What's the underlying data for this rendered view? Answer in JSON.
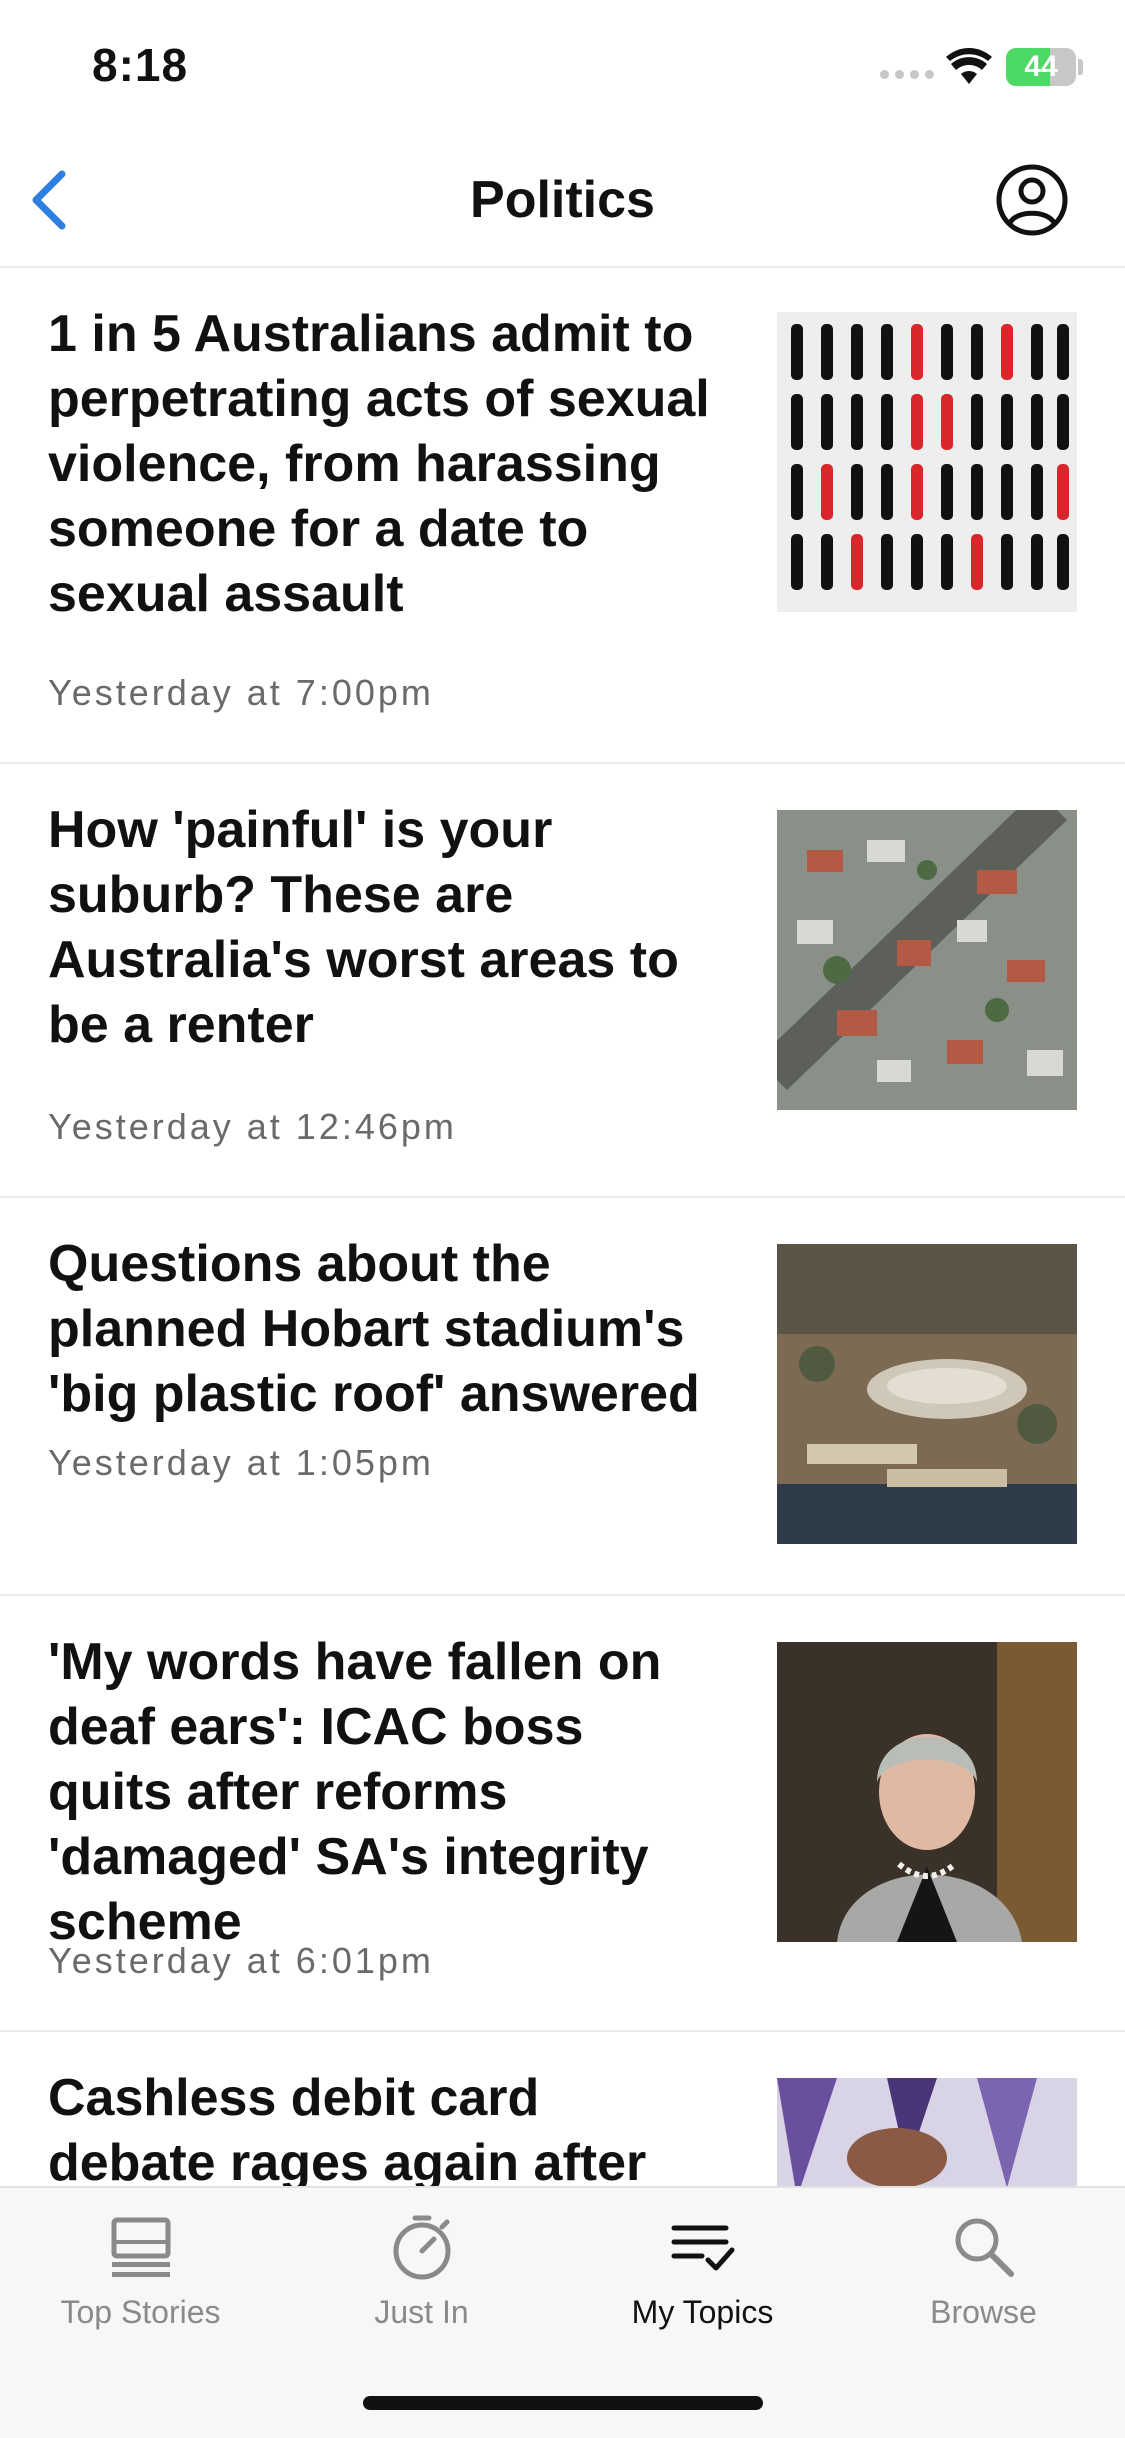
{
  "status_bar": {
    "time": "8:18",
    "battery": "44",
    "battery_color": "#4cd964"
  },
  "nav": {
    "title": "Politics",
    "back_icon": "chevron-left-icon",
    "profile_icon": "user-circle-icon",
    "accent_color": "#2f7ee0"
  },
  "articles": [
    {
      "headline": "1 in 5 Australians admit to perpetrating acts of sexual violence, from harassing someone for a date to sexual assault",
      "timestamp": "Yesterday at 7:00pm"
    },
    {
      "headline": "How 'painful' is your suburb? These are Australia's worst areas to be a renter",
      "timestamp": "Yesterday at 12:46pm"
    },
    {
      "headline": "Questions about the planned Hobart stadium's 'big plastic roof' answered",
      "timestamp": "Yesterday at 1:05pm"
    },
    {
      "headline": "'My words have fallen on deaf ears': ICAC boss quits after reforms 'damaged' SA's integrity scheme",
      "timestamp": "Yesterday at 6:01pm"
    },
    {
      "headline": "Cashless debit card debate rages again after",
      "timestamp": ""
    }
  ],
  "tabs": [
    {
      "label": "Top Stories",
      "icon": "laptop-icon",
      "active": false
    },
    {
      "label": "Just In",
      "icon": "stopwatch-icon",
      "active": false
    },
    {
      "label": "My Topics",
      "icon": "list-check-icon",
      "active": true
    },
    {
      "label": "Browse",
      "icon": "search-icon",
      "active": false
    }
  ]
}
